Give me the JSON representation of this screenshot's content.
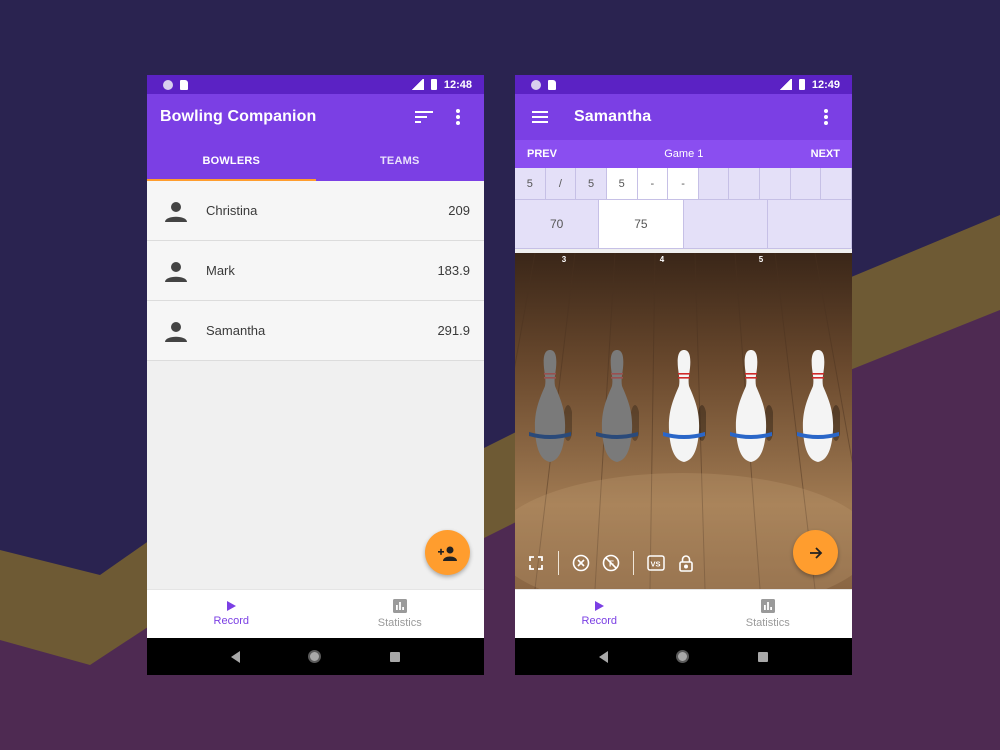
{
  "colors": {
    "status_bar": "#5b22c4",
    "primary": "#7b3fe4",
    "game_nav": "#8a4ef0",
    "accent": "#ff9d2e",
    "score_bg": "#e4e0f8"
  },
  "left_screen": {
    "status_time": "12:48",
    "app_title": "Bowling Companion",
    "toolbar_icons": [
      "sort-icon",
      "more-vert-icon"
    ],
    "tabs": [
      {
        "label": "BOWLERS",
        "active": true
      },
      {
        "label": "TEAMS",
        "active": false
      }
    ],
    "bowlers": [
      {
        "name": "Christina",
        "score": "209"
      },
      {
        "name": "Mark",
        "score": "183.9"
      },
      {
        "name": "Samantha",
        "score": "291.9"
      }
    ],
    "fab_icon": "add-person-icon",
    "bottom_nav": [
      {
        "label": "Record",
        "icon": "play-icon",
        "active": true
      },
      {
        "label": "Statistics",
        "icon": "chart-icon",
        "active": false
      }
    ]
  },
  "right_screen": {
    "status_time": "12:49",
    "bowler_title": "Samantha",
    "game_nav": {
      "prev": "PREV",
      "game": "Game 1",
      "next": "NEXT"
    },
    "balls": [
      "5",
      "/",
      "5",
      "5",
      "-",
      "-",
      "",
      "",
      "",
      "",
      ""
    ],
    "frame_totals": [
      "70",
      "75",
      "",
      ""
    ],
    "pin_numbers": [
      "3",
      "4",
      "5"
    ],
    "pins": [
      {
        "standing": false
      },
      {
        "standing": false
      },
      {
        "standing": true
      },
      {
        "standing": true
      },
      {
        "standing": true
      }
    ],
    "lane_tools": [
      "fullscreen-icon",
      "clear-icon",
      "foul-icon",
      "vs-icon",
      "lock-icon"
    ],
    "fab_icon": "arrow-forward-icon",
    "bottom_nav": [
      {
        "label": "Record",
        "icon": "play-icon",
        "active": true
      },
      {
        "label": "Statistics",
        "icon": "chart-icon",
        "active": false
      }
    ]
  }
}
